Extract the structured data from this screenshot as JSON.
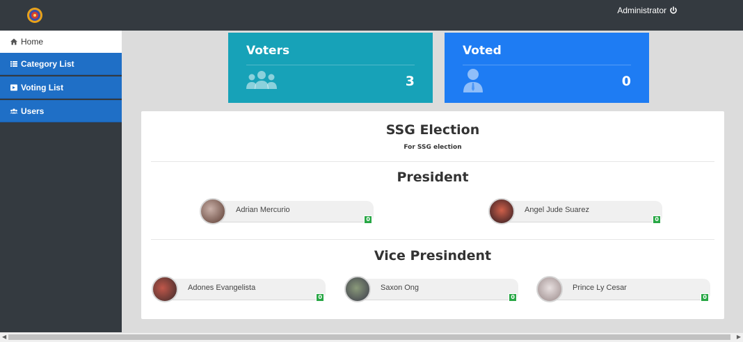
{
  "header": {
    "user": "Administrator"
  },
  "sidebar": {
    "items": [
      {
        "label": "Home",
        "icon": "home-icon"
      },
      {
        "label": "Category List",
        "icon": "list-icon"
      },
      {
        "label": "Voting List",
        "icon": "ballot-icon"
      },
      {
        "label": "Users",
        "icon": "users-icon"
      }
    ]
  },
  "cards": {
    "voters": {
      "title": "Voters",
      "value": "3",
      "color": "#17a2b8"
    },
    "voted": {
      "title": "Voted",
      "value": "0",
      "color": "#1e7cf3"
    }
  },
  "election": {
    "title": "SSG Election",
    "description": "For SSG election",
    "positions": [
      {
        "name": "President",
        "candidates": [
          {
            "name": "Adrian Mercurio",
            "votes": "0"
          },
          {
            "name": "Angel Jude Suarez",
            "votes": "0"
          }
        ]
      },
      {
        "name": "Vice Presindent",
        "candidates": [
          {
            "name": "Adones Evangelista",
            "votes": "0"
          },
          {
            "name": "Saxon Ong",
            "votes": "0"
          },
          {
            "name": "Prince Ly Cesar",
            "votes": "0"
          }
        ]
      }
    ]
  },
  "colors": {
    "sidebar_blue": "#1f6fc6",
    "topbar": "#343a40",
    "badge_green": "#28a745"
  }
}
